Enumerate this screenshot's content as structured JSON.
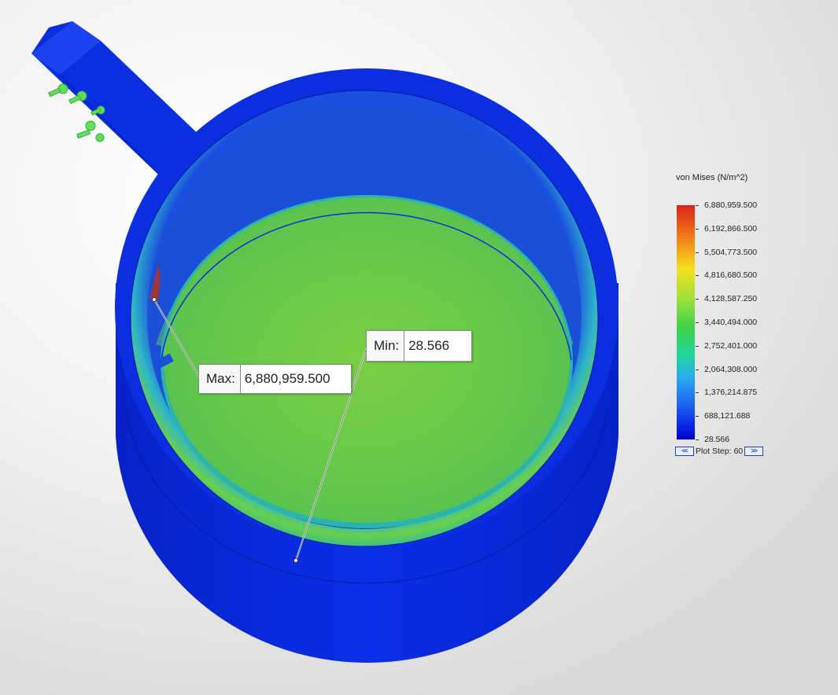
{
  "callouts": {
    "max": {
      "label": "Max:",
      "value": "6,880,959.500"
    },
    "min": {
      "label": "Min:",
      "value": "28.566"
    }
  },
  "legend": {
    "title": "von Mises (N/m^2)",
    "ticks": [
      "6,880,959.500",
      "6,192,866.500",
      "5,504,773.500",
      "4,816,680.500",
      "4,128,587.250",
      "3,440,494.000",
      "2,752,401.000",
      "2,064,308.000",
      "1,376,214.875",
      "688,121.688",
      "28.566"
    ],
    "plot_step_text": "Plot Step: 60",
    "prev_glyph": "<<",
    "next_glyph": ">>",
    "colors": [
      "#d8241c",
      "#f07018",
      "#f6e01e",
      "#9ee03a",
      "#3fd24a",
      "#22d69c",
      "#2aa8f0",
      "#1f6cf0",
      "#0000cc"
    ]
  },
  "model": {
    "body_color": "#0a2ee0",
    "inner_wall_color": "#5fcc4a",
    "bottom_color": "#66c845",
    "fixture_color": "#5fe05a",
    "hotspot_color": "#c0301a"
  }
}
